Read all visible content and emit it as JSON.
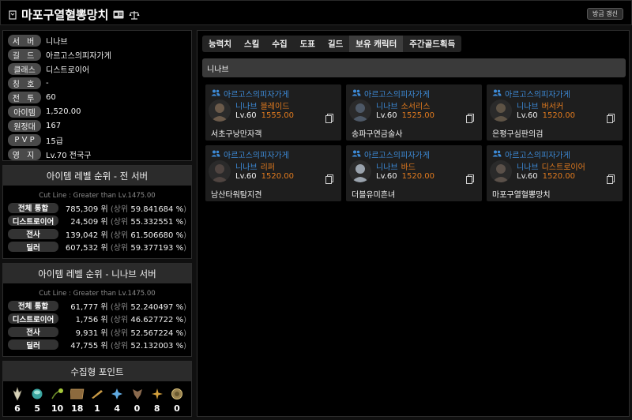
{
  "header": {
    "title": "마포구열혈뽕망치",
    "refresh_label": "방금 갱신"
  },
  "info": [
    {
      "label": "서 버",
      "value": "니나브"
    },
    {
      "label": "길 드",
      "value": "아르고스의피자가게"
    },
    {
      "label": "클래스",
      "value": "디스트로이어"
    },
    {
      "label": "칭 호",
      "value": "-"
    },
    {
      "label": "전 투",
      "value": "60"
    },
    {
      "label": "아이템",
      "value": "1,520.00"
    },
    {
      "label": "원정대",
      "value": "167"
    },
    {
      "label": "P V P",
      "value": "15급"
    },
    {
      "label": "영 지",
      "value": "Lv.70 전국구"
    }
  ],
  "rank_all": {
    "title": "아이템 레벨 순위 - 전 서버",
    "cutline": "Cut Line : Greater than Lv.1475.00",
    "rows": [
      {
        "label": "전체 통합",
        "rank": "785,309 위",
        "pct": "59.841684 %"
      },
      {
        "label": "디스트로이어",
        "rank": "24,509 위",
        "pct": "55.332551 %"
      },
      {
        "label": "전사",
        "rank": "139,042 위",
        "pct": "61.506680 %"
      },
      {
        "label": "딜러",
        "rank": "607,532 위",
        "pct": "59.377193 %"
      }
    ]
  },
  "rank_server": {
    "title": "아이템 레벨 순위 - 니나브 서버",
    "cutline": "Cut Line : Greater than Lv.1475.00",
    "rows": [
      {
        "label": "전체 통합",
        "rank": "61,777 위",
        "pct": "52.240497 %"
      },
      {
        "label": "디스트로이어",
        "rank": "1,756 위",
        "pct": "46.627722 %"
      },
      {
        "label": "전사",
        "rank": "9,931 위",
        "pct": "52.567224 %"
      },
      {
        "label": "딜러",
        "rank": "47,755 위",
        "pct": "52.132003 %"
      }
    ]
  },
  "rank_labels": {
    "upper": "(상위",
    "close": ")"
  },
  "collect": {
    "title": "수집형 포인트",
    "items": [
      {
        "icon": "mokoko-seed-icon",
        "count": "6"
      },
      {
        "icon": "island-heart-icon",
        "count": "5"
      },
      {
        "icon": "giant-heart-icon",
        "count": "10"
      },
      {
        "icon": "art-icon",
        "count": "18"
      },
      {
        "icon": "ignea-token-icon",
        "count": "1"
      },
      {
        "icon": "orpheus-star-icon",
        "count": "4"
      },
      {
        "icon": "worldtree-leaf-icon",
        "count": "0"
      },
      {
        "icon": "voyage-icon",
        "count": "8"
      },
      {
        "icon": "sea-bounty-icon",
        "count": "0"
      }
    ]
  },
  "tabs": [
    {
      "label": "능력치",
      "active": false
    },
    {
      "label": "스킬",
      "active": false
    },
    {
      "label": "수집",
      "active": false
    },
    {
      "label": "도표",
      "active": false
    },
    {
      "label": "길드",
      "active": false
    },
    {
      "label": "보유 캐릭터",
      "active": true
    },
    {
      "label": "주간골드획득",
      "active": false
    }
  ],
  "server_bar": "니나브",
  "characters": [
    {
      "guild": "아르고스의피자가게",
      "server": "니나브",
      "class": "블레이드",
      "level": "Lv.60",
      "ilvl": "1555.00",
      "name": "서초구낭만자객",
      "avatar_color": "#6b5a4a"
    },
    {
      "guild": "아르고스의피자가게",
      "server": "니나브",
      "class": "소서리스",
      "level": "Lv.60",
      "ilvl": "1525.00",
      "name": "송파구연금술사",
      "avatar_color": "#4d5866"
    },
    {
      "guild": "아르고스의피자가게",
      "server": "니나브",
      "class": "버서커",
      "level": "Lv.60",
      "ilvl": "1520.00",
      "name": "은평구심판의검",
      "avatar_color": "#5e5345"
    },
    {
      "guild": "아르고스의피자가게",
      "server": "니나브",
      "class": "리퍼",
      "level": "Lv.60",
      "ilvl": "1520.00",
      "name": "남산타워탐지견",
      "avatar_color": "#4f4440"
    },
    {
      "guild": "아르고스의피자가게",
      "server": "니나브",
      "class": "바드",
      "level": "Lv.60",
      "ilvl": "1520.00",
      "name": "더블유미흔녀",
      "avatar_color": "#9aa3ad"
    },
    {
      "guild": "아르고스의피자가게",
      "server": "니나브",
      "class": "디스트로이어",
      "level": "Lv.60",
      "ilvl": "1520.00",
      "name": "마포구열혈뽕망치",
      "avatar_color": "#5a5049"
    }
  ]
}
